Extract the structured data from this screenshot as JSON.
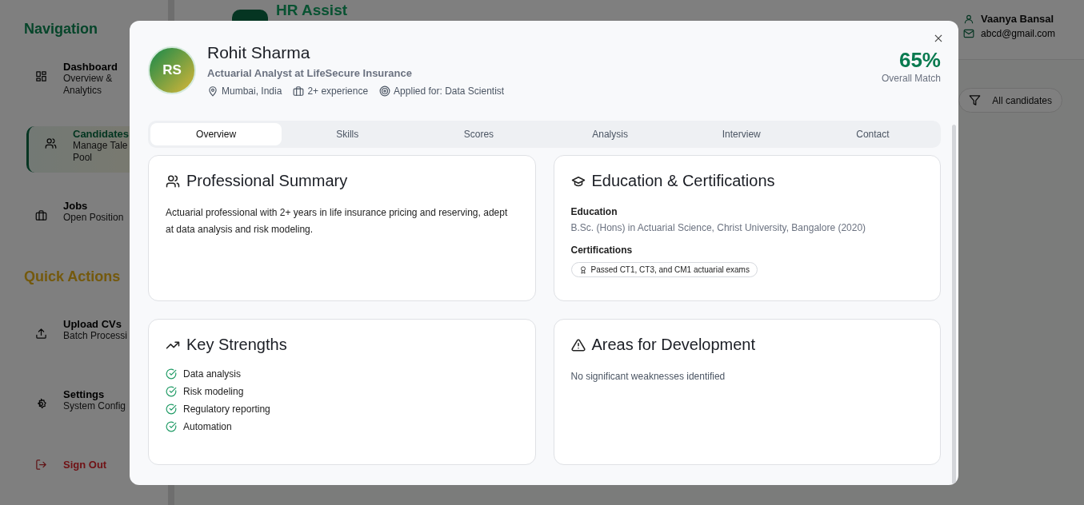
{
  "app": {
    "logo": "HR Assist",
    "user": {
      "name": "Vaanya Bansal",
      "email": "abcd@gmail.com"
    },
    "filter": "All candidates",
    "sections": [
      {
        "title": "Navigation",
        "kind": "nav",
        "items": [
          {
            "title": "Dashboard",
            "subtitle_lines": [
              "Overview &",
              "Analytics"
            ],
            "selected": false
          },
          {
            "title": "Candidates",
            "subtitle_lines": [
              "Manage Tale",
              "Pool"
            ],
            "selected": true
          },
          {
            "title": "Jobs",
            "subtitle_lines": [
              "Open Position"
            ],
            "selected": false
          }
        ]
      },
      {
        "title": "Quick Actions",
        "kind": "actions",
        "items": [
          {
            "title": "Upload CVs",
            "subtitle_lines": [
              "Batch Processi"
            ],
            "selected": false
          },
          {
            "title": "Settings",
            "subtitle_lines": [
              "System Config"
            ],
            "selected": false
          }
        ]
      }
    ],
    "sign_out": "Sign Out"
  },
  "modal": {
    "initials": "RS",
    "name": "Rohit Sharma",
    "headline": "Actuarial Analyst at LifeSecure Insurance",
    "meta": [
      "Mumbai, India",
      "2+ experience",
      "Applied for: Data Scientist"
    ],
    "match": "65%",
    "match_label": "Overall Match",
    "tabs": [
      {
        "label": "Overview",
        "selected": true
      },
      {
        "label": "Skills",
        "selected": false
      },
      {
        "label": "Scores",
        "selected": false
      },
      {
        "label": "Analysis",
        "selected": false
      },
      {
        "label": "Interview",
        "selected": false
      },
      {
        "label": "Contact",
        "selected": false
      }
    ],
    "summary": {
      "title": "Professional Summary",
      "text": "Actuarial professional with 2+ years in life insurance pricing and reserving, adept at data analysis and risk modeling."
    },
    "education": {
      "title": "Education & Certifications",
      "education_label": "Education",
      "education": "B.Sc. (Hons) in Actuarial Science, Christ University, Bangalore (2020)",
      "certifications_label": "Certifications",
      "certifications": [
        "Passed CT1, CT3, and CM1 actuarial exams"
      ]
    },
    "strengths": {
      "title": "Key Strengths",
      "items": [
        "Data analysis",
        "Risk modeling",
        "Regulatory reporting",
        "Automation"
      ]
    },
    "development": {
      "title": "Areas for Development",
      "text": "No significant weaknesses identified"
    }
  }
}
